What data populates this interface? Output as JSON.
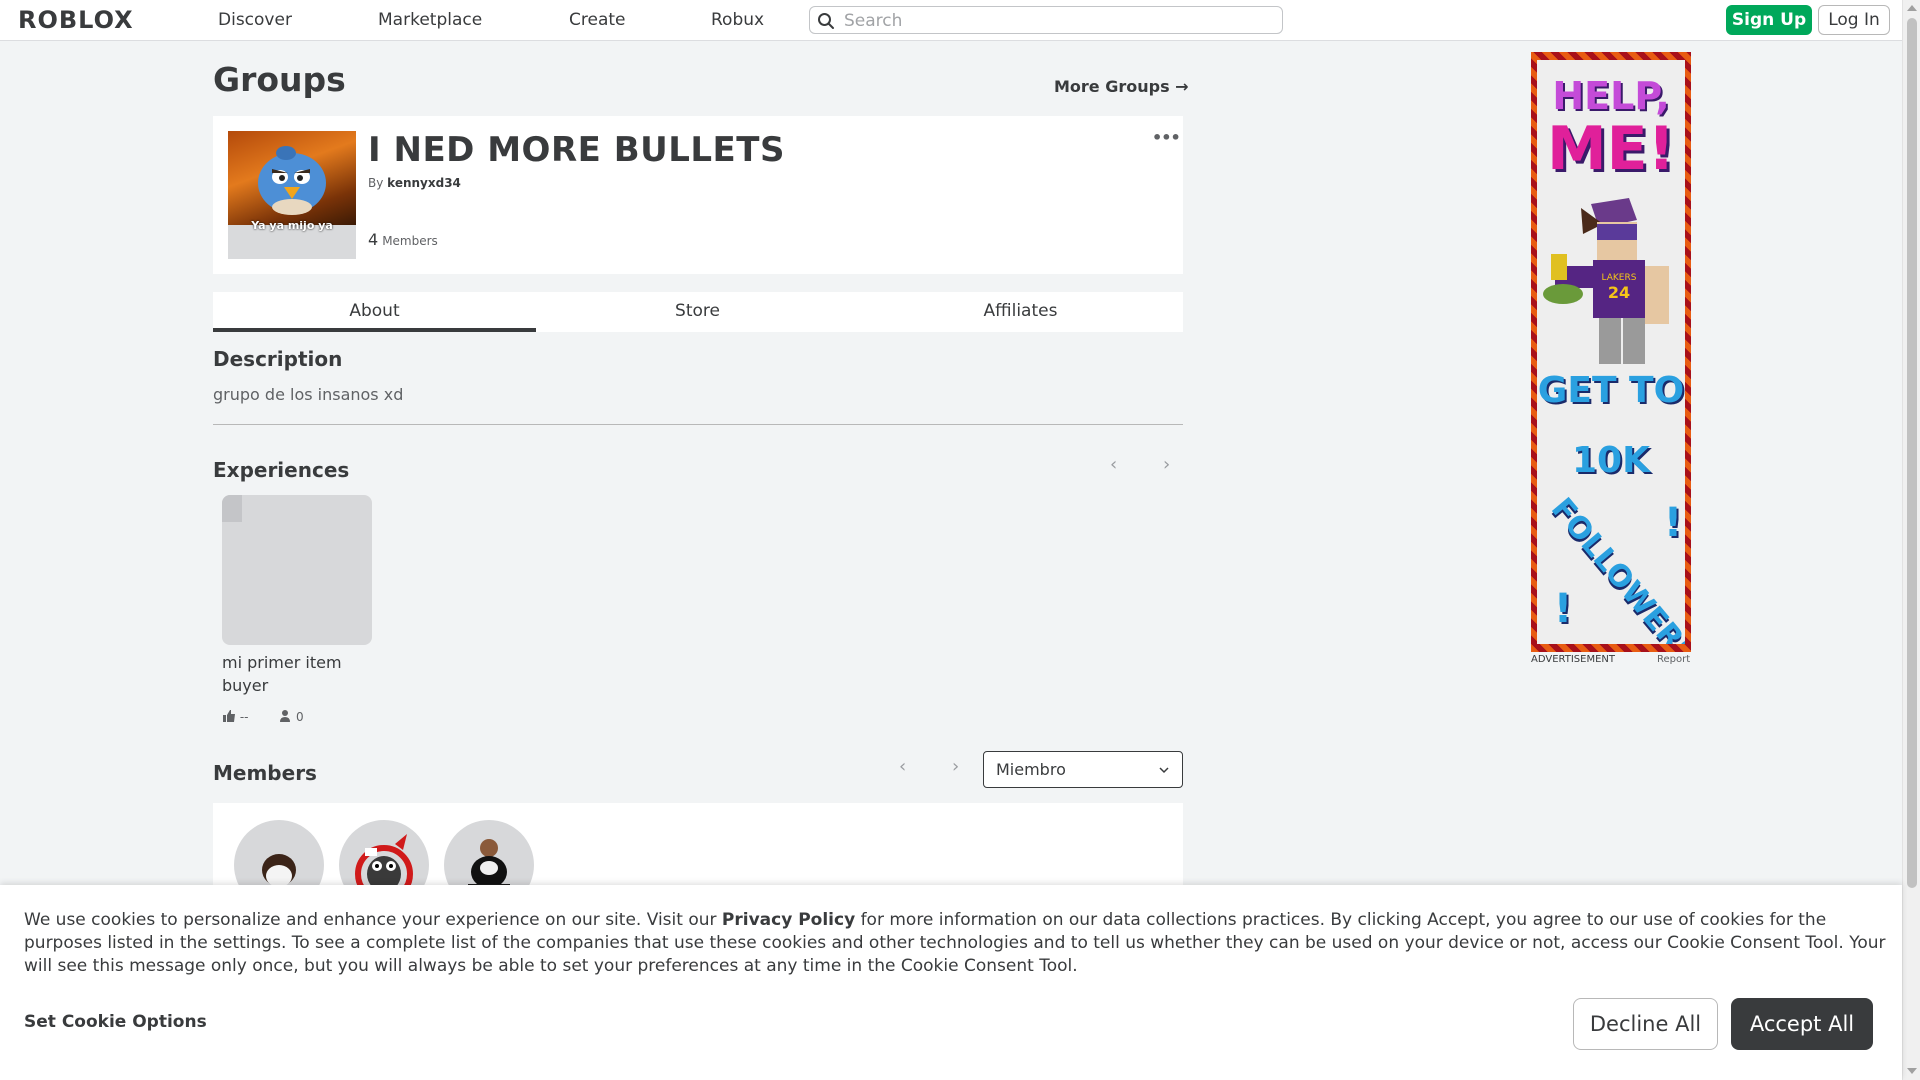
{
  "nav": {
    "logo": "ROBLOX",
    "links": [
      "Discover",
      "Marketplace",
      "Create",
      "Robux"
    ],
    "search_placeholder": "Search",
    "signup_label": "Sign Up",
    "login_label": "Log In"
  },
  "page": {
    "title": "Groups",
    "more_groups": "More Groups →"
  },
  "group": {
    "emblem_caption": "Ya ya mijo ya",
    "name": "I NED MORE BULLETS",
    "by_label": "By",
    "owner": "kennyxd34",
    "member_count": "4",
    "members_label": "Members",
    "more_icon": "•••"
  },
  "tabs": [
    "About",
    "Store",
    "Affiliates"
  ],
  "about": {
    "description_heading": "Description",
    "description": "grupo de los insanos xd",
    "experiences_heading": "Experiences",
    "experience": {
      "name": "mi primer item buyer",
      "rating": "--",
      "players": "0"
    },
    "members_heading": "Members",
    "role_selected": "Miembro"
  },
  "ad": {
    "lines": [
      "HELP,",
      "ME!",
      "GET TO",
      "10K",
      "FOLLOWERS",
      "!",
      "!"
    ],
    "jersey_number": "24",
    "jersey_team": "LAKERS",
    "label": "ADVERTISEMENT",
    "report": "Report"
  },
  "cookie": {
    "text_before": "We use cookies to personalize and enhance your experience on our site. Visit our ",
    "policy_link": "Privacy Policy",
    "text_after": " for more information on our data collections practices. By clicking Accept, you agree to our use of cookies for the purposes listed in the settings. To see a complete list of the companies that use these cookies and other technologies and to tell us whether they can be used on your device or not, access our Cookie Consent Tool. Your will see this message only once, but you will always be able to set your preferences at any time in the Cookie Consent Tool.",
    "options_label": "Set Cookie Options",
    "decline_label": "Decline All",
    "accept_label": "Accept All"
  },
  "colors": {
    "accent_green": "#00a85a",
    "text_dark": "#393b3d",
    "background": "#f2f4f5"
  }
}
